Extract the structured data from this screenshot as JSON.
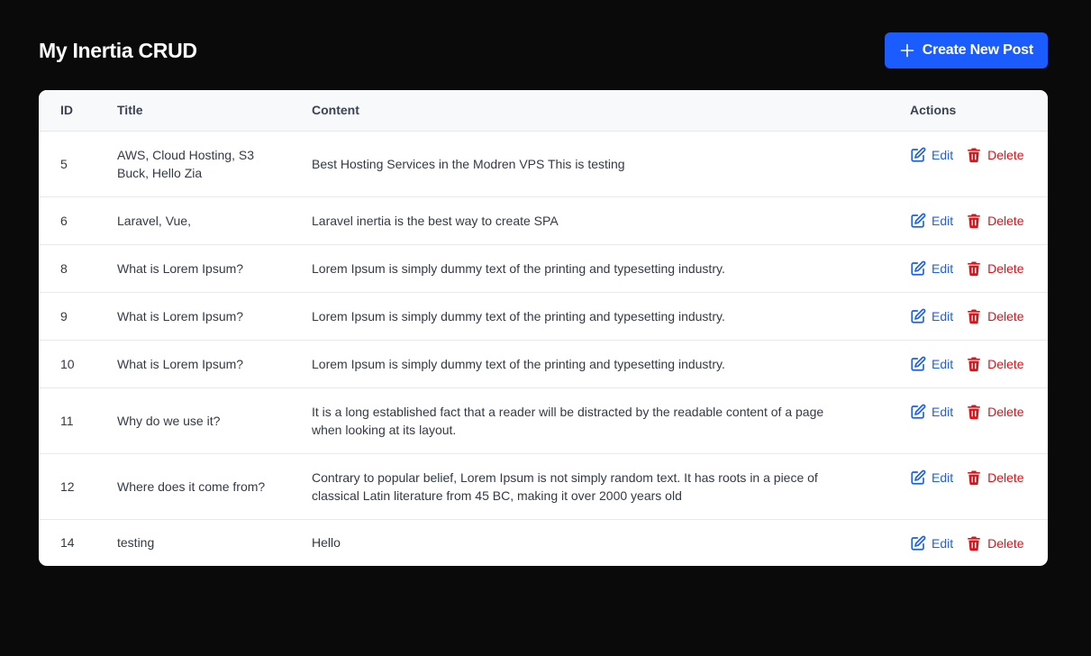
{
  "app": {
    "title": "My Inertia CRUD",
    "create_label": "Create New Post"
  },
  "table": {
    "headers": {
      "id": "ID",
      "title": "Title",
      "content": "Content",
      "actions": "Actions"
    },
    "edit_label": "Edit",
    "delete_label": "Delete",
    "rows": [
      {
        "id": "5",
        "title": "AWS, Cloud Hosting, S3 Buck, Hello Zia",
        "content": "Best Hosting Services in the Modren VPS This is testing"
      },
      {
        "id": "6",
        "title": "Laravel, Vue,",
        "content": "Laravel inertia is the best way to create SPA"
      },
      {
        "id": "8",
        "title": "What is Lorem Ipsum?",
        "content": "Lorem Ipsum is simply dummy text of the printing and typesetting industry."
      },
      {
        "id": "9",
        "title": "What is Lorem Ipsum?",
        "content": "Lorem Ipsum is simply dummy text of the printing and typesetting industry."
      },
      {
        "id": "10",
        "title": "What is Lorem Ipsum?",
        "content": "Lorem Ipsum is simply dummy text of the printing and typesetting industry."
      },
      {
        "id": "11",
        "title": "Why do we use it?",
        "content": "It is a long established fact that a reader will be distracted by the readable content of a page when looking at its layout."
      },
      {
        "id": "12",
        "title": "Where does it come from?",
        "content": "Contrary to popular belief, Lorem Ipsum is not simply random text. It has roots in a piece of classical Latin literature from 45 BC, making it over 2000 years old"
      },
      {
        "id": "14",
        "title": "testing",
        "content": "Hello"
      }
    ]
  },
  "colors": {
    "background": "#0a0a0a",
    "accent": "#1a5cff",
    "edit": "#1d5fe6",
    "delete": "#d9141b"
  },
  "icons": {
    "create": "plus-icon",
    "edit": "edit-icon",
    "delete": "trash-icon"
  }
}
